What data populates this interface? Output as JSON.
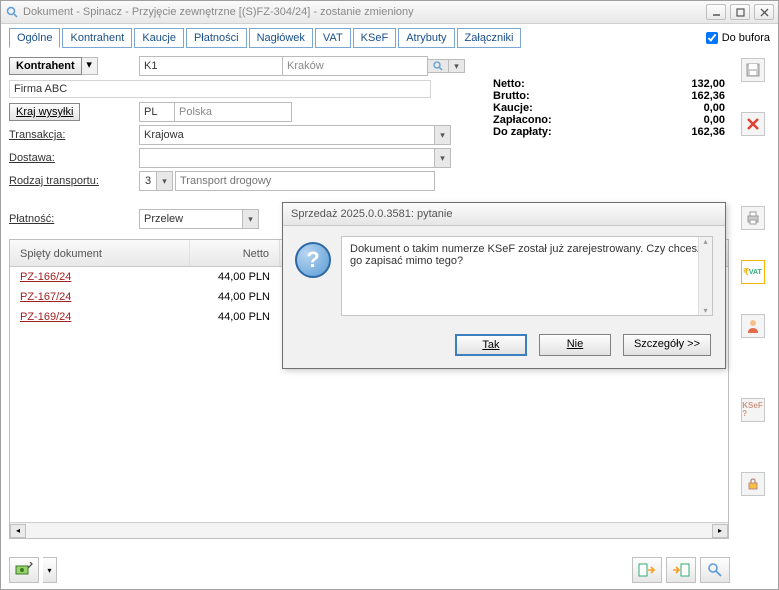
{
  "titlebar": {
    "title": "Dokument - Spinacz - Przyjęcie zewnętrzne [(S)FZ-304/24]  - zostanie zmieniony"
  },
  "tabs": [
    "Ogólne",
    "Kontrahent",
    "Kaucje",
    "Płatności",
    "Nagłówek",
    "VAT",
    "KSeF",
    "Atrybuty",
    "Załączniki"
  ],
  "doBufora": "Do bufora",
  "form": {
    "kontrahent_btn": "Kontrahent",
    "kontrahent_code": "K1",
    "kontrahent_city": "Kraków",
    "firma": "Firma ABC",
    "kraj_btn": "Kraj wysyłki",
    "kraj_code": "PL",
    "kraj_name": "Polska",
    "transakcja_lbl": "Transakcja:",
    "transakcja_val": "Krajowa",
    "dostawa_lbl": "Dostawa:",
    "dostawa_val": "",
    "rodzaj_lbl": "Rodzaj transportu:",
    "rodzaj_code": "3",
    "rodzaj_name": "Transport drogowy",
    "platnosc_lbl": "Płatność:",
    "platnosc_val": "Przelew"
  },
  "totals": {
    "netto_lbl": "Netto:",
    "netto_val": "132,00",
    "brutto_lbl": "Brutto:",
    "brutto_val": "162,36",
    "kaucje_lbl": "Kaucje:",
    "kaucje_val": "0,00",
    "zaplacono_lbl": "Zapłacono:",
    "zaplacono_val": "0,00",
    "do_zaplaty_lbl": "Do zapłaty:",
    "do_zaplaty_val": "162,36"
  },
  "grid": {
    "col1": "Spięty dokument",
    "col2": "Netto",
    "rows": [
      {
        "doc": "PZ-166/24",
        "netto": "44,00 PLN"
      },
      {
        "doc": "PZ-167/24",
        "netto": "44,00 PLN"
      },
      {
        "doc": "PZ-169/24",
        "netto": "44,00 PLN"
      }
    ]
  },
  "dialog": {
    "title": "Sprzedaż 2025.0.0.3581: pytanie",
    "message": "Dokument o takim numerze KSeF został już zarejestrowany. Czy chcesz go zapisać mimo tego?",
    "yes": "Tak",
    "no": "Nie",
    "details": "Szczegóły >>"
  },
  "icons": {
    "save": "save",
    "close": "close",
    "print": "print",
    "vat": "vat",
    "user": "user",
    "ksef": "ksef",
    "lock": "lock"
  }
}
